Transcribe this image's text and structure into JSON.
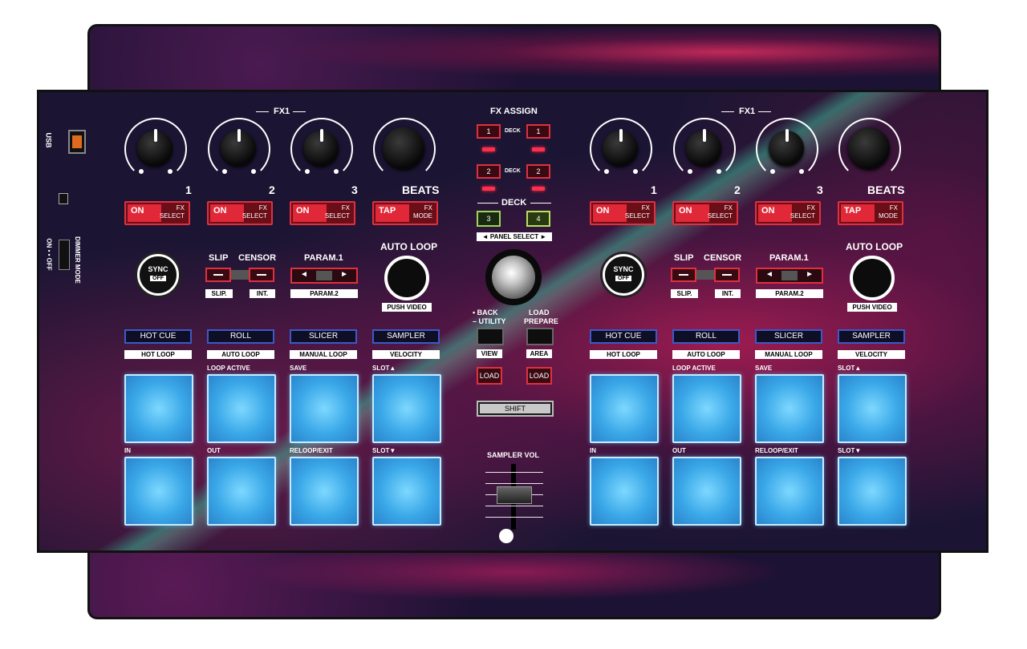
{
  "left_panel": {
    "usb": "USB",
    "dimmer": "DIMMER MODE",
    "onoff": "ON • • OFF"
  },
  "deck_left": {
    "fx_header": "FX1",
    "knob_nums": [
      "1",
      "2",
      "3"
    ],
    "beats": "BEATS",
    "fx_buttons": [
      {
        "a": "ON",
        "b1": "FX",
        "b2": "SELECT"
      },
      {
        "a": "ON",
        "b1": "FX",
        "b2": "SELECT"
      },
      {
        "a": "ON",
        "b1": "FX",
        "b2": "SELECT"
      },
      {
        "a": "TAP",
        "b1": "FX",
        "b2": "MODE"
      }
    ],
    "sync": "SYNC",
    "sync_off": "OFF",
    "slip": "SLIP",
    "censor": "CENSOR",
    "slip_sub": "SLIP.",
    "int_sub": "INT.",
    "param1": "PARAM.1",
    "param2": "PARAM.2",
    "auto_loop": "AUTO LOOP",
    "push_video": "PUSH VIDEO",
    "modes": [
      "HOT CUE",
      "ROLL",
      "SLICER",
      "SAMPLER"
    ],
    "mode_labels": [
      "HOT LOOP",
      "AUTO LOOP",
      "MANUAL LOOP",
      "VELOCITY"
    ],
    "pad_top_labels": [
      "",
      "LOOP ACTIVE",
      "SAVE",
      "SLOT▲"
    ],
    "pad_bottom_labels": [
      "IN",
      "OUT",
      "RELOOP/EXIT",
      "SLOT▼"
    ]
  },
  "deck_right": {
    "fx_header": "FX1",
    "knob_nums": [
      "1",
      "2",
      "3"
    ],
    "beats": "BEATS",
    "fx_buttons": [
      {
        "a": "ON",
        "b1": "FX",
        "b2": "SELECT"
      },
      {
        "a": "ON",
        "b1": "FX",
        "b2": "SELECT"
      },
      {
        "a": "ON",
        "b1": "FX",
        "b2": "SELECT"
      },
      {
        "a": "TAP",
        "b1": "FX",
        "b2": "MODE"
      }
    ],
    "sync": "SYNC",
    "sync_off": "OFF",
    "slip": "SLIP",
    "censor": "CENSOR",
    "slip_sub": "SLIP.",
    "int_sub": "INT.",
    "param1": "PARAM.1",
    "param2": "PARAM.2",
    "auto_loop": "AUTO LOOP",
    "push_video": "PUSH VIDEO",
    "modes": [
      "HOT CUE",
      "ROLL",
      "SLICER",
      "SAMPLER"
    ],
    "mode_labels": [
      "HOT LOOP",
      "AUTO LOOP",
      "MANUAL LOOP",
      "VELOCITY"
    ],
    "pad_top_labels": [
      "",
      "LOOP ACTIVE",
      "SAVE",
      "SLOT▲"
    ],
    "pad_bottom_labels": [
      "IN",
      "OUT",
      "RELOOP/EXIT",
      "SLOT▼"
    ]
  },
  "center": {
    "fx_assign": "FX ASSIGN",
    "deck_word": "DECK",
    "assign_rows": [
      [
        "1",
        "DECK",
        "1"
      ],
      [
        "2",
        "DECK",
        "2"
      ]
    ],
    "deck_header": "DECK",
    "deck_buttons": [
      "3",
      "4"
    ],
    "panel_select": "◄ PANEL SELECT ►",
    "back": "• BACK",
    "utility": "– UTILITY",
    "load": "LOAD",
    "prepare": "PREPARE",
    "view": "VIEW",
    "area": "AREA",
    "load_btn": "LOAD",
    "shift": "SHIFT",
    "sampler_vol": "SAMPLER VOL"
  }
}
